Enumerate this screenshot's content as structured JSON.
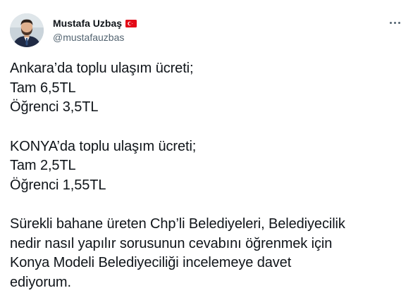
{
  "author": {
    "display_name": "Mustafa Uzbaş",
    "handle": "@mustafauzbas",
    "badge_icon": "turkey-flag-icon",
    "avatar": "profile-photo"
  },
  "menu_icon": "more-horizontal-icon",
  "colors": {
    "text": "#0f1419",
    "secondary_text": "#536471",
    "flag_red": "#e30a17"
  },
  "tweet": {
    "paragraph1": {
      "line1": "Ankara’da toplu ulaşım ücreti;",
      "line2": "Tam 6,5TL",
      "line3": "Öğrenci 3,5TL"
    },
    "paragraph2": {
      "line1": "KONYA’da toplu ulaşım ücreti;",
      "line2": "Tam 2,5TL",
      "line3": "Öğrenci 1,55TL"
    },
    "paragraph3": {
      "line1": "Sürekli bahane üreten Chp’li Belediyeleri, Belediyecilik",
      "line2": "nedir nasıl yapılır sorusunun cevabını öğrenmek için",
      "line3": "Konya Modeli Belediyeciliği incelemeye davet",
      "line4": "ediyorum."
    }
  }
}
